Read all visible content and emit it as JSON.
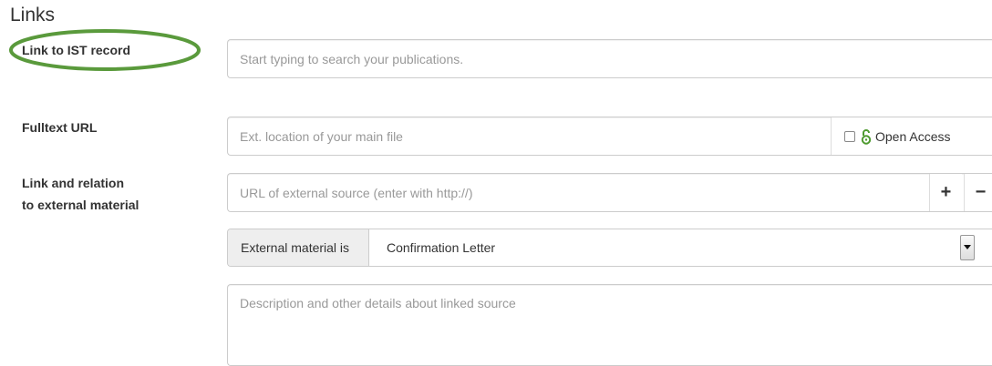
{
  "section": {
    "title": "Links"
  },
  "fields": {
    "ist_record": {
      "label": "Link to IST record",
      "placeholder": "Start typing to search your publications."
    },
    "fulltext": {
      "label": "Fulltext URL",
      "placeholder": "Ext. location of your main file",
      "open_access_label": "Open Access",
      "open_access_checked": false
    },
    "external": {
      "label_line1": "Link and relation",
      "label_line2": "to external material",
      "url_placeholder": "URL of external source (enter with http://)",
      "add_label": "+",
      "remove_label": "−",
      "relation_prefix": "External material is",
      "relation_value": "Confirmation Letter",
      "description_placeholder": "Description and other details about linked source"
    }
  },
  "icons": {
    "open_access": "open-lock-icon",
    "dropdown": "chevron-down-icon"
  },
  "colors": {
    "highlight_ellipse": "#5a9a3c",
    "open_access_icon": "#4e9a2f"
  }
}
